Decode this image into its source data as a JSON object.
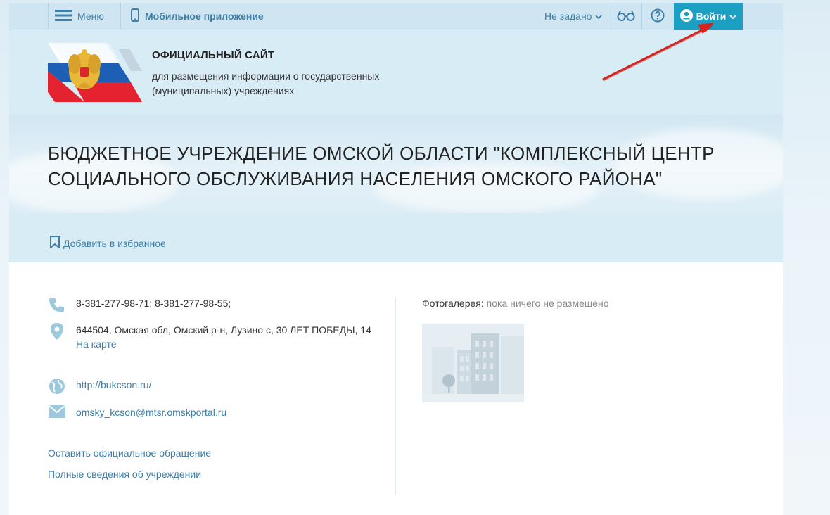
{
  "topbar": {
    "menu_label": "Меню",
    "mobile_label": "Мобильное приложение",
    "region_label": "Не задано",
    "login_label": "Войти"
  },
  "header": {
    "title": "ОФИЦИАЛЬНЫЙ САЙТ",
    "subtitle": "для размещения информации о государственных (муниципальных) учреждениях"
  },
  "organization": {
    "name": "БЮДЖЕТНОЕ УЧРЕЖДЕНИЕ ОМСКОЙ ОБЛАСТИ \"КОМПЛЕКСНЫЙ ЦЕНТР СОЦИАЛЬНОГО ОБСЛУЖИВАНИЯ НАСЕЛЕНИЯ ОМСКОГО РАЙОНА\"",
    "favorite_label": "Добавить в избранное"
  },
  "contacts": {
    "phone": "8-381-277-98-71; 8-381-277-98-55;",
    "address": "644504, Омская обл, Омский р-н, Лузино с, 30 ЛЕТ ПОБЕДЫ, 14",
    "map_link": "На карте",
    "website": "http://bukcson.ru/",
    "email": "omsky_kcson@mtsr.omskportal.ru"
  },
  "links": {
    "appeal": "Оставить официальное обращение",
    "full_info": "Полные сведения об учреждении"
  },
  "gallery": {
    "label": "Фотогалерея:",
    "status": "пока ничего не размещено"
  },
  "colors": {
    "accent": "#1ba0c4",
    "link": "#3f7ea6",
    "header_bg": "#d8ecf6",
    "annotation_arrow": "#d9201c"
  },
  "icons": [
    "menu-icon",
    "phone-icon",
    "chevron-down-icon",
    "glasses-icon",
    "help-icon",
    "user-icon",
    "bookmark-icon",
    "location-icon",
    "globe-icon",
    "mail-icon"
  ]
}
